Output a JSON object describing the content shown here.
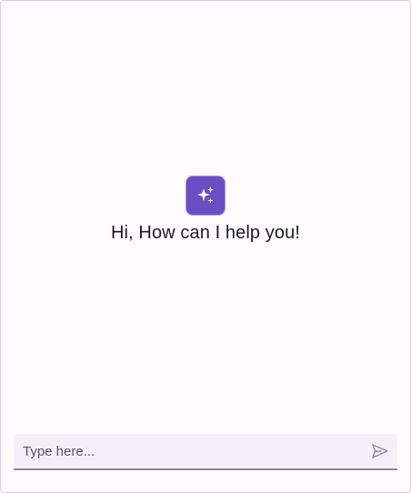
{
  "welcome": {
    "message": "Hi, How can I help you!",
    "avatar_icon": "sparkles-icon",
    "avatar_color": "#6a4fc4"
  },
  "composer": {
    "placeholder": "Type here...",
    "value": "",
    "send_icon": "send-icon"
  }
}
